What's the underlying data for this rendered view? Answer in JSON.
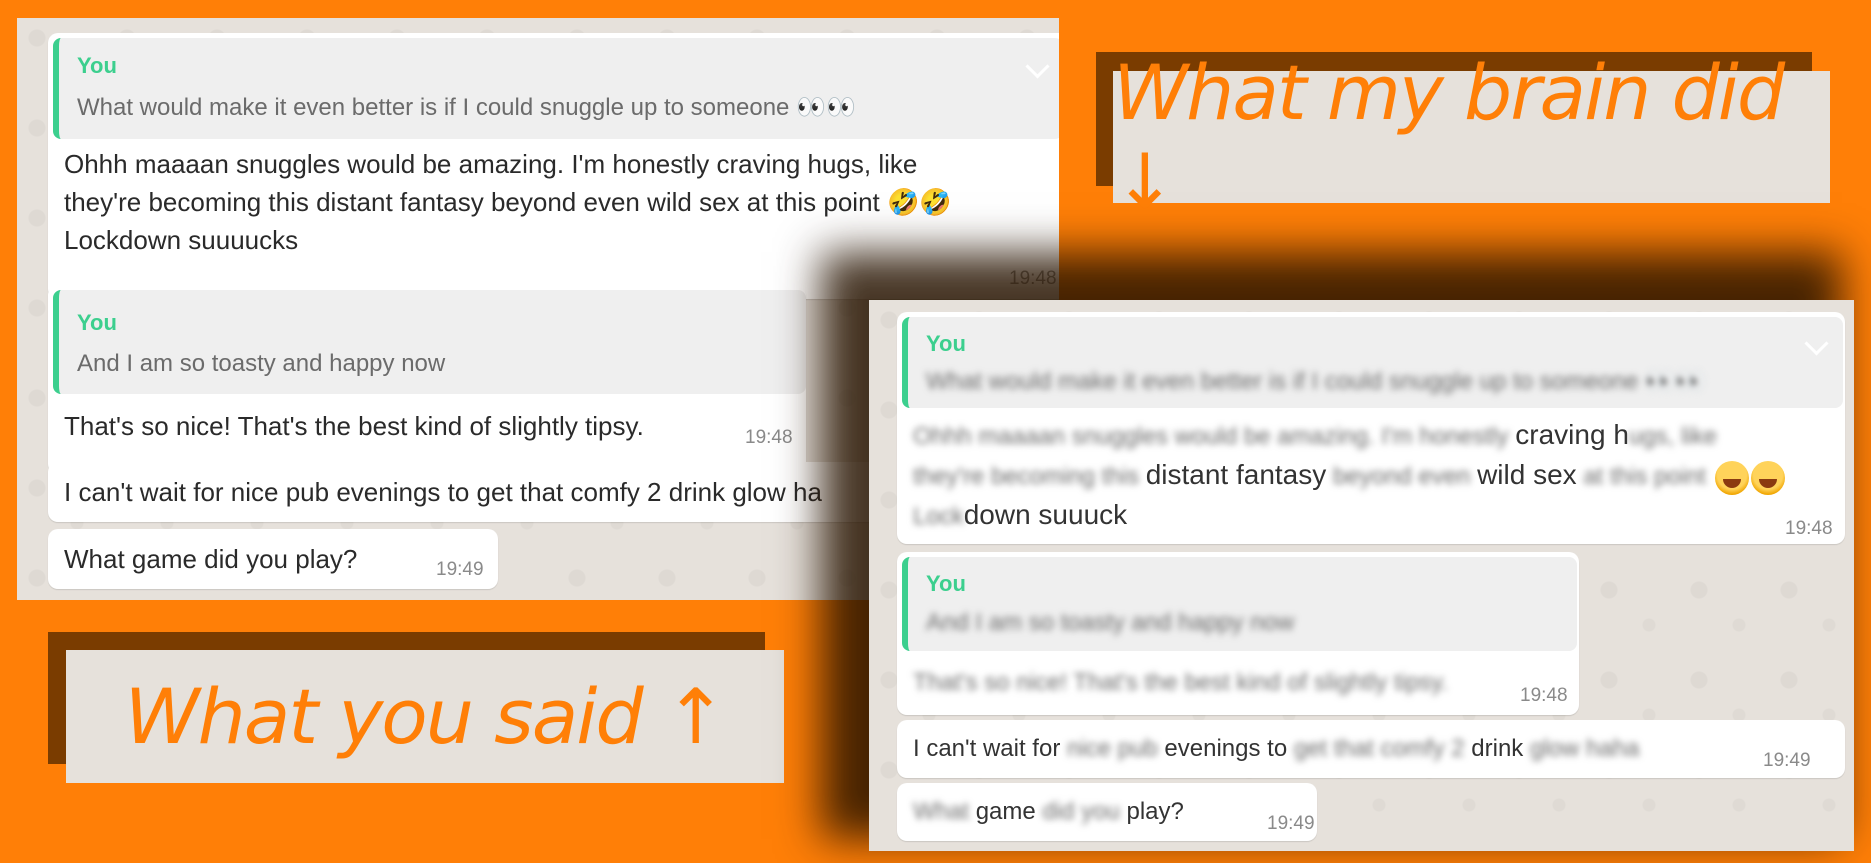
{
  "left_chat": {
    "quote1": {
      "author": "You",
      "text": "What would make it even better is if I could snuggle up to someone 👀👀"
    },
    "msg1": {
      "line1": "Ohhh maaaan snuggles would be amazing. I'm honestly craving hugs, like",
      "line2": "they're becoming this distant fantasy beyond even wild sex at this point 🤣🤣",
      "line3": "Lockdown suuuucks",
      "time": "19:48"
    },
    "quote2": {
      "author": "You",
      "text": "And I am so toasty and happy now"
    },
    "msg2": {
      "text": "That's so nice! That's the best kind of slightly tipsy.",
      "time": "19:48"
    },
    "msg3": {
      "text": "I can't wait for nice pub evenings to get that comfy 2 drink glow ha"
    },
    "msg4": {
      "text": "What game did you play?",
      "time": "19:49"
    }
  },
  "right_chat": {
    "quote1": {
      "author": "You",
      "text": "What would make it even better is if I could snuggle up to someone 👀👀"
    },
    "msg1": {
      "l1_blur": "Ohhh maaaan snuggles would be amazing. I'm honestly",
      "l1_clear": "craving h",
      "l1_blur2": "ugs, like",
      "l2_blur": "they're becoming this",
      "l2_clear1": "distant fantasy",
      "l2_blur2": "beyond even",
      "l2_clear2": "wild sex",
      "l2_blur3": "at this point",
      "l3_blur": "Lock",
      "l3_clear": "down suuuck",
      "time": "19:48"
    },
    "quote2": {
      "author": "You",
      "text": "And I am so toasty and happy now"
    },
    "msg2": {
      "text": "That's so nice! That's the best kind of slightly tipsy.",
      "time": "19:48"
    },
    "msg3": {
      "clear1": "I can't wait for",
      "blur1": "nice pub",
      "clear2": "evenings to",
      "blur2": "get that comfy 2",
      "clear3": "drink",
      "blur3": "glow haha",
      "time": "19:49"
    },
    "msg4": {
      "blur1": "What",
      "clear1": "game",
      "blur2": "did you",
      "clear2": "play?",
      "time": "19:49"
    }
  },
  "labels": {
    "brain": "What my brain did ↓",
    "said": "What you said  ↑"
  },
  "colors": {
    "background": "#ff7f07",
    "quote_bar": "#3ccf8e",
    "label_text": "#ff7f07",
    "label_box": "#e6e1db"
  }
}
